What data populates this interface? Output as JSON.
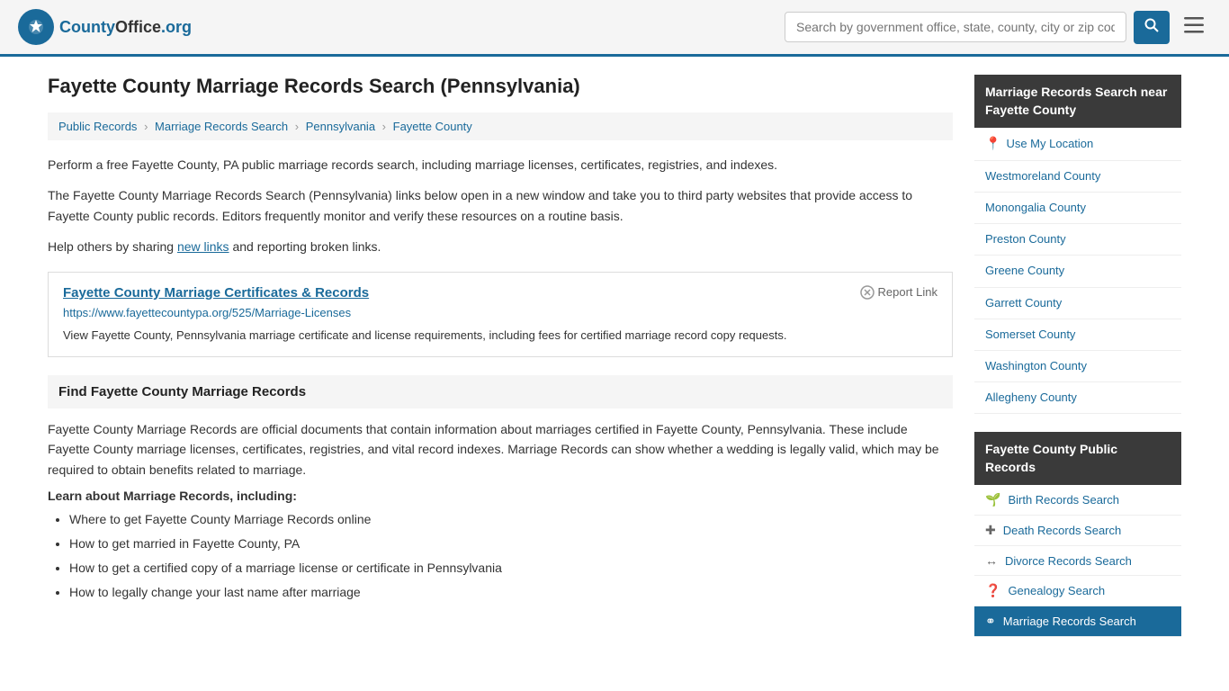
{
  "header": {
    "logo_text": "CountyOffice",
    "logo_suffix": ".org",
    "search_placeholder": "Search by government office, state, county, city or zip code",
    "search_button_label": "🔍",
    "menu_button_label": "☰"
  },
  "page": {
    "title": "Fayette County Marriage Records Search (Pennsylvania)",
    "breadcrumb": [
      {
        "label": "Public Records",
        "href": "#"
      },
      {
        "label": "Marriage Records Search",
        "href": "#"
      },
      {
        "label": "Pennsylvania",
        "href": "#"
      },
      {
        "label": "Fayette County",
        "href": "#"
      }
    ],
    "desc1": "Perform a free Fayette County, PA public marriage records search, including marriage licenses, certificates, registries, and indexes.",
    "desc2": "The Fayette County Marriage Records Search (Pennsylvania) links below open in a new window and take you to third party websites that provide access to Fayette County public records. Editors frequently monitor and verify these resources on a routine basis.",
    "desc3_pre": "Help others by sharing ",
    "desc3_link": "new links",
    "desc3_post": " and reporting broken links.",
    "link_card": {
      "title": "Fayette County Marriage Certificates & Records",
      "url": "https://www.fayettecountypa.org/525/Marriage-Licenses",
      "desc": "View Fayette County, Pennsylvania marriage certificate and license requirements, including fees for certified marriage record copy requests.",
      "report_label": "Report Link"
    },
    "find_section": {
      "title": "Find Fayette County Marriage Records",
      "text": "Fayette County Marriage Records are official documents that contain information about marriages certified in Fayette County, Pennsylvania. These include Fayette County marriage licenses, certificates, registries, and vital record indexes. Marriage Records can show whether a wedding is legally valid, which may be required to obtain benefits related to marriage.",
      "learn_heading": "Learn about Marriage Records, including:",
      "bullets": [
        "Where to get Fayette County Marriage Records online",
        "How to get married in Fayette County, PA",
        "How to get a certified copy of a marriage license or certificate in Pennsylvania",
        "How to legally change your last name after marriage"
      ]
    }
  },
  "sidebar": {
    "nearby_header": "Marriage Records Search near Fayette County",
    "nearby_items": [
      {
        "label": "Use My Location",
        "icon": "📍",
        "location": true
      },
      {
        "label": "Westmoreland County"
      },
      {
        "label": "Monongalia County"
      },
      {
        "label": "Preston County"
      },
      {
        "label": "Greene County"
      },
      {
        "label": "Garrett County"
      },
      {
        "label": "Somerset County"
      },
      {
        "label": "Washington County"
      },
      {
        "label": "Allegheny County"
      }
    ],
    "public_records_header": "Fayette County Public Records",
    "public_records_items": [
      {
        "label": "Birth Records Search",
        "icon": "🌱"
      },
      {
        "label": "Death Records Search",
        "icon": "✚"
      },
      {
        "label": "Divorce Records Search",
        "icon": "↔"
      },
      {
        "label": "Genealogy Search",
        "icon": "❓"
      },
      {
        "label": "Marriage Records Search",
        "icon": "⚭",
        "active": true
      }
    ]
  }
}
